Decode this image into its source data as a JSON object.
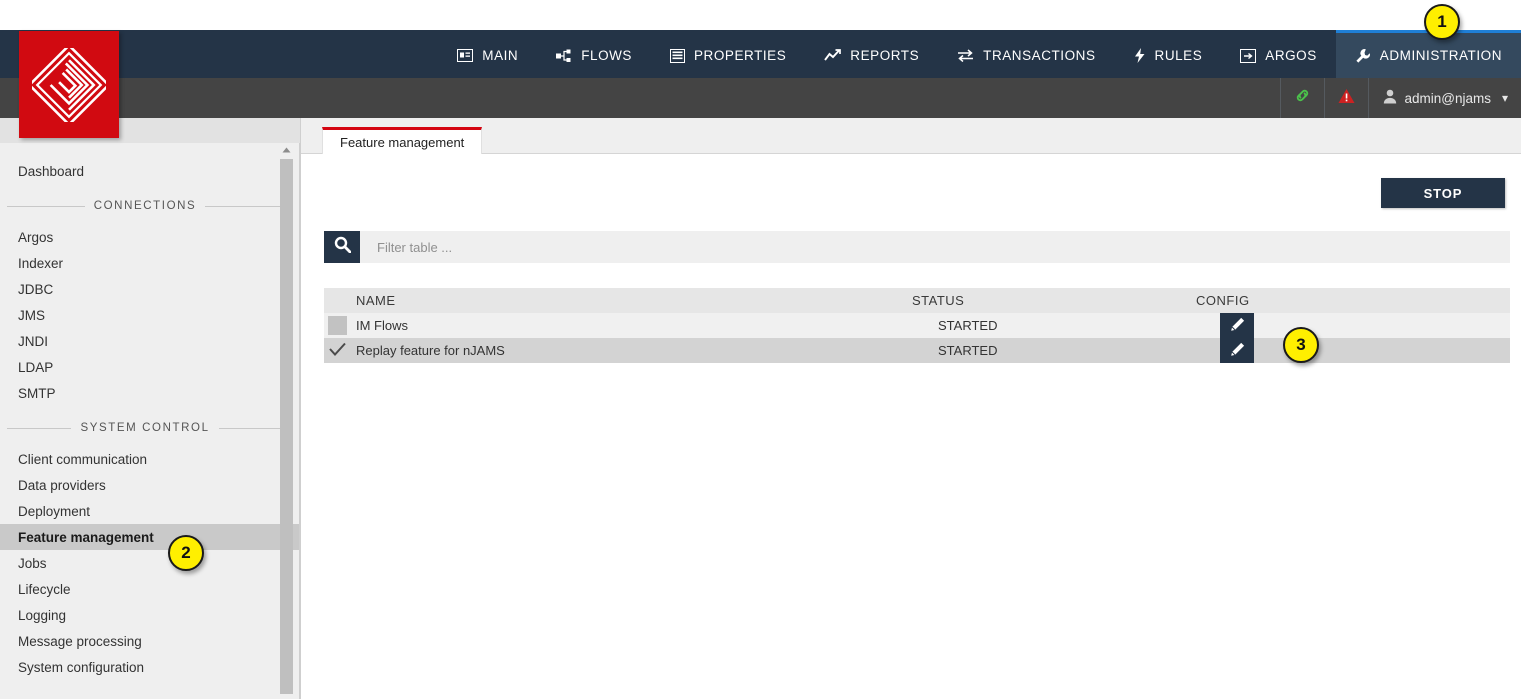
{
  "brand": {
    "logo_name": "njams-logo",
    "logo_color": "#d10a11"
  },
  "topnav": {
    "items": [
      {
        "label": "MAIN",
        "icon": "card-list-icon",
        "active": false
      },
      {
        "label": "FLOWS",
        "icon": "flows-nodes-icon",
        "active": false
      },
      {
        "label": "PROPERTIES",
        "icon": "list-box-icon",
        "active": false
      },
      {
        "label": "REPORTS",
        "icon": "chart-line-icon",
        "active": false
      },
      {
        "label": "TRANSACTIONS",
        "icon": "transfer-arrows-icon",
        "active": false
      },
      {
        "label": "RULES",
        "icon": "lightning-bolt-icon",
        "active": false
      },
      {
        "label": "ARGOS",
        "icon": "framed-arrow-icon",
        "active": false
      },
      {
        "label": "ADMINISTRATION",
        "icon": "wrench-icon",
        "active": true
      }
    ],
    "active_accent": "#1f7fd6",
    "background": "#243447"
  },
  "subbar": {
    "link_icon": "link-chain-icon",
    "link_color": "#4bc24b",
    "warning_icon": "warning-triangle-icon",
    "warning_color": "#cc2222",
    "user_icon": "person-icon",
    "user_label": "admin@njams",
    "chevron": "chevron-down-icon",
    "background": "#444444"
  },
  "sidebar": {
    "top_items": [
      {
        "label": "Dashboard",
        "active": false
      }
    ],
    "groups": [
      {
        "title": "CONNECTIONS",
        "items": [
          {
            "label": "Argos",
            "active": false
          },
          {
            "label": "Indexer",
            "active": false
          },
          {
            "label": "JDBC",
            "active": false
          },
          {
            "label": "JMS",
            "active": false
          },
          {
            "label": "JNDI",
            "active": false
          },
          {
            "label": "LDAP",
            "active": false
          },
          {
            "label": "SMTP",
            "active": false
          }
        ]
      },
      {
        "title": "SYSTEM CONTROL",
        "items": [
          {
            "label": "Client communication",
            "active": false
          },
          {
            "label": "Data providers",
            "active": false
          },
          {
            "label": "Deployment",
            "active": false
          },
          {
            "label": "Feature management",
            "active": true
          },
          {
            "label": "Jobs",
            "active": false
          },
          {
            "label": "Lifecycle",
            "active": false
          },
          {
            "label": "Logging",
            "active": false
          },
          {
            "label": "Message processing",
            "active": false
          },
          {
            "label": "System configuration",
            "active": false
          }
        ]
      }
    ],
    "scrollbar": {
      "up_arrow_icon": "scroll-up-arrow-icon"
    }
  },
  "content": {
    "tab": {
      "label": "Feature management",
      "accent": "#d40511"
    },
    "stop_button": {
      "label": "STOP",
      "background": "#243447"
    },
    "filter": {
      "search_icon": "search-icon",
      "placeholder": "Filter table ...",
      "value": ""
    },
    "table": {
      "columns": [
        "NAME",
        "STATUS",
        "CONFIG"
      ],
      "rows": [
        {
          "checkbox": "gray-box",
          "name": "IM Flows",
          "status": "STARTED",
          "config_icon": "pencil-edit-icon",
          "selected": false
        },
        {
          "checkbox": "checkmark",
          "name": "Replay feature for nJAMS",
          "status": "STARTED",
          "config_icon": "pencil-edit-icon",
          "selected": true
        }
      ]
    }
  },
  "annotations": [
    {
      "number": "1",
      "target": "administration-nav-tab"
    },
    {
      "number": "2",
      "target": "sidebar-item-feature-management"
    },
    {
      "number": "3",
      "target": "config-edit-button-row-2"
    }
  ]
}
